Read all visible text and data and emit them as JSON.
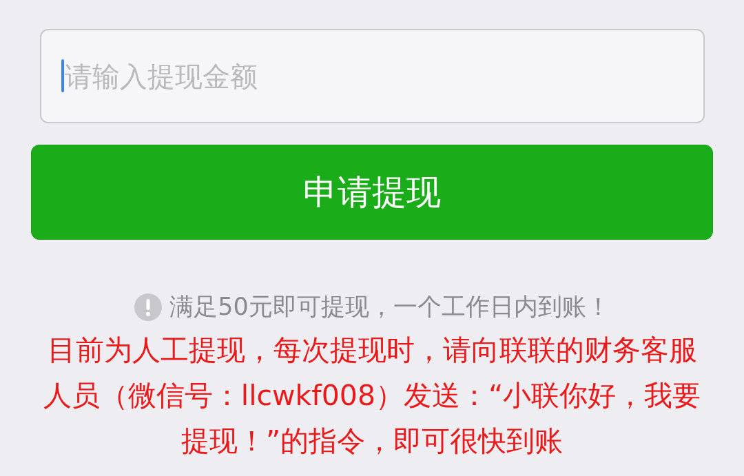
{
  "amount_field": {
    "placeholder": "请输入提现金额"
  },
  "submit_button": {
    "label": "申请提现"
  },
  "notice": "满足50元即可提现，一个工作日内到账！",
  "instructions": "目前为人工提现，每次提现时，请向联联的财务客服人员（微信号：llcwkf008）发送：“小联你好，我要提现！”的指令，即可很快到账"
}
